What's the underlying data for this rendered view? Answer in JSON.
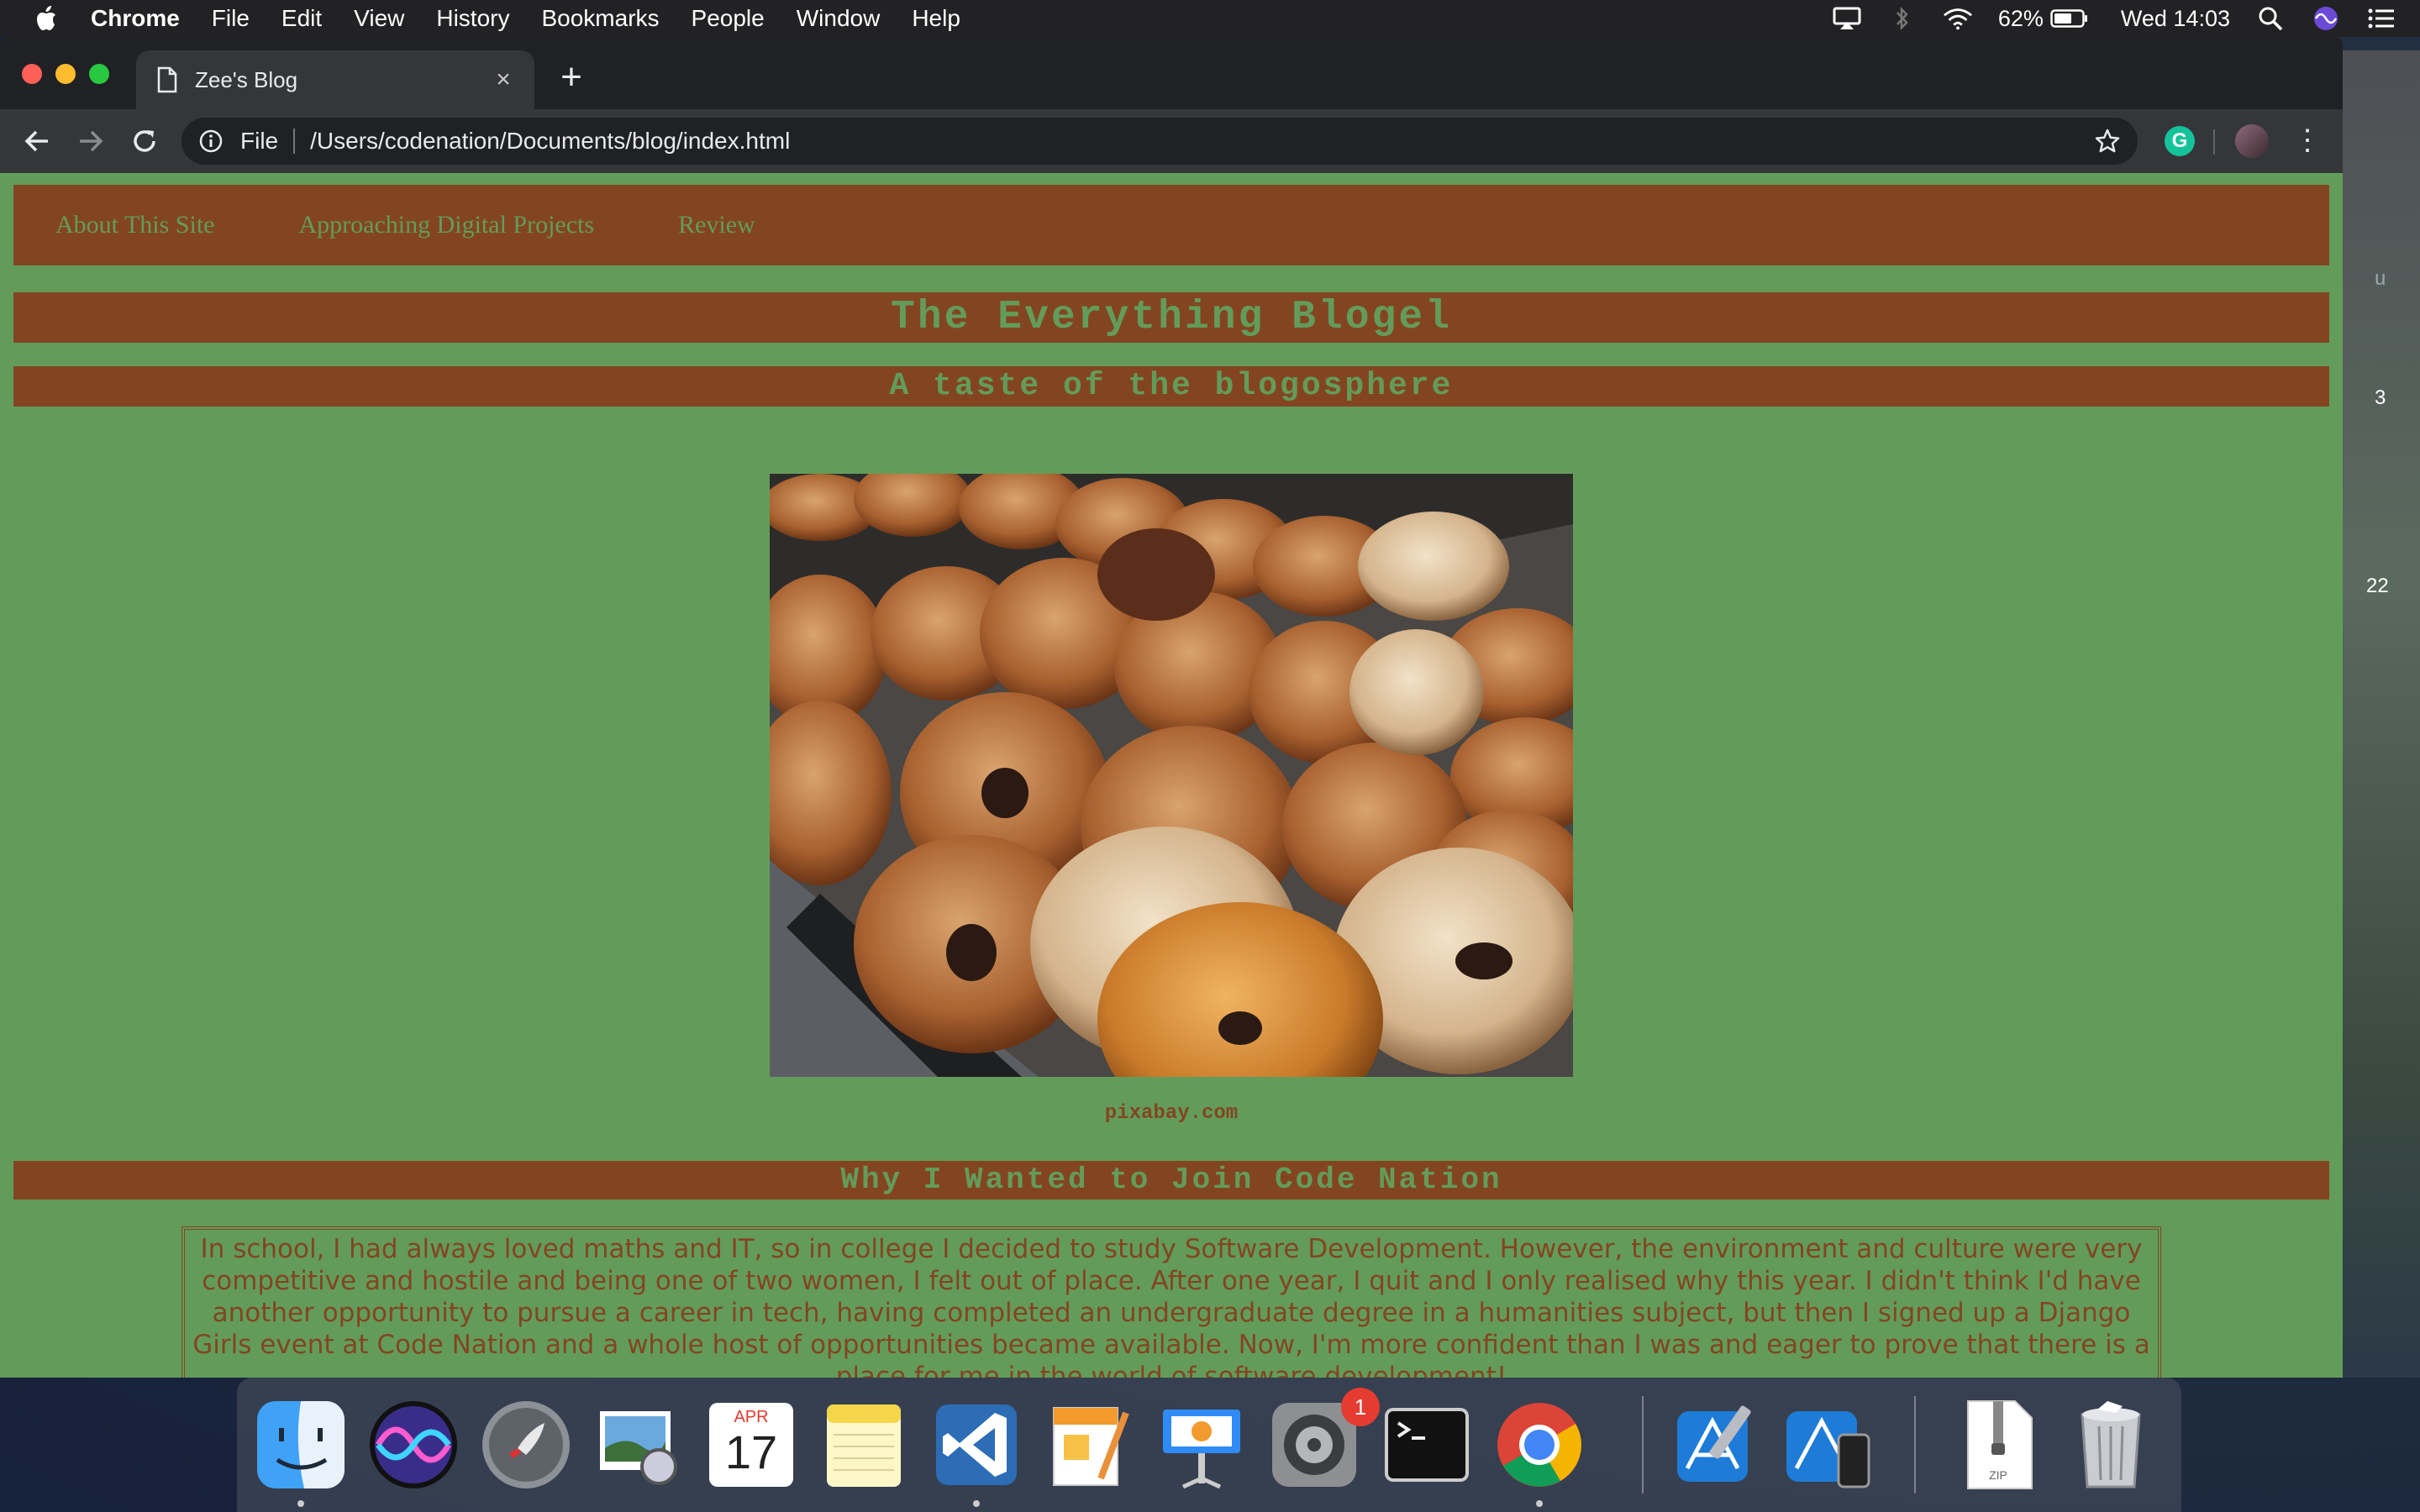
{
  "menubar": {
    "app_name": "Chrome",
    "items": [
      "File",
      "Edit",
      "View",
      "History",
      "Bookmarks",
      "People",
      "Window",
      "Help"
    ],
    "battery": "62%",
    "clock": "Wed 14:03"
  },
  "browser": {
    "tab_title": "Zee's Blog",
    "scheme_label": "File",
    "url": "/Users/codenation/Documents/blog/index.html",
    "extension_label": "G"
  },
  "page": {
    "nav": [
      "About This Site",
      "Approaching Digital Projects",
      "Review"
    ],
    "title": "The Everything Blogel",
    "subtitle": "A taste of the blogosphere",
    "image_caption": "pixabay.com",
    "section_heading": "Why I Wanted to Join Code Nation",
    "section_text": "In school, I had always loved maths and IT, so in college I decided to study Software Development. However, the environment and culture were very competitive and hostile and being one of two women, I felt out of place. After one year, I quit and I only realised why this year. I didn't think I'd have another opportunity to pursue a career in tech, having completed an undergraduate degree in a humanities subject, but then I signed up a Django Girls event at Code Nation and a whole host of opportunities became available. Now, I'm more confident than I was and eager to prove that there is a place for me in the world of software development!"
  },
  "dock": {
    "calendar_month": "APR",
    "calendar_day": "17",
    "settings_badge": "1",
    "zip_label": "ZIP",
    "apps": [
      "Finder",
      "Siri",
      "Launchpad",
      "Preview",
      "Calendar",
      "Notes",
      "Visual Studio Code",
      "Pages",
      "Keynote",
      "System Preferences",
      "Terminal",
      "Google Chrome",
      "Xcode",
      "Simulator",
      "Archive",
      "Trash"
    ]
  },
  "desktop": {
    "edge_fragments": [
      "u",
      "3",
      "22"
    ]
  },
  "colors": {
    "page_bg": "#639c5a",
    "banner_bg": "#834521",
    "chrome_dark": "#202124",
    "chrome_toolbar": "#35363a"
  }
}
